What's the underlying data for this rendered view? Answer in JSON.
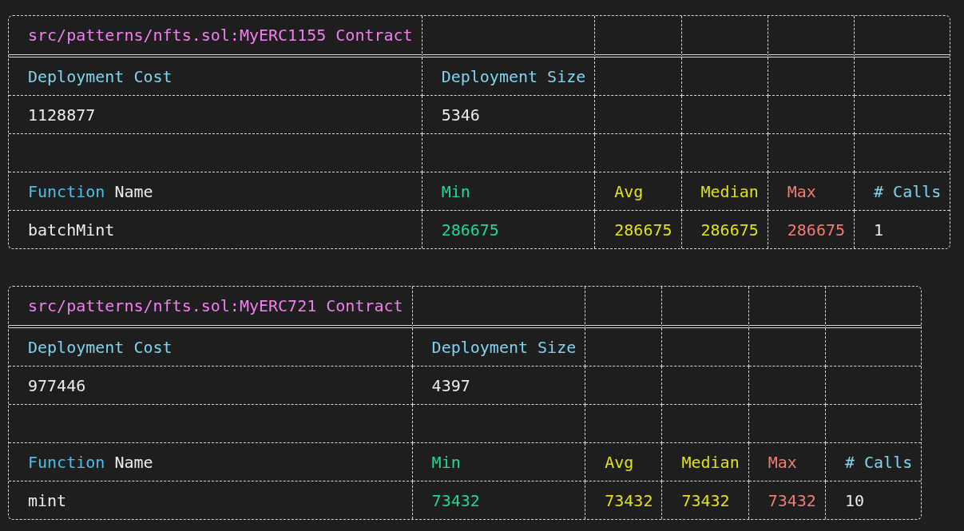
{
  "tables": [
    {
      "title": "src/patterns/nfts.sol:MyERC1155 Contract",
      "rows": [
        {
          "kind": "data",
          "cells": [
            {
              "parts": [
                {
                  "text": "Deployment Cost",
                  "color": "#7fd4ef"
                }
              ]
            },
            {
              "parts": [
                {
                  "text": "Deployment Size",
                  "color": "#7fd4ef"
                }
              ]
            }
          ]
        },
        {
          "kind": "data",
          "cells": [
            {
              "parts": [
                {
                  "text": "1128877",
                  "color": "#ececec"
                }
              ]
            },
            {
              "parts": [
                {
                  "text": "5346",
                  "color": "#ececec"
                }
              ]
            }
          ]
        },
        {
          "kind": "blank"
        },
        {
          "kind": "data",
          "cells": [
            {
              "parts": [
                {
                  "text": "Function",
                  "color": "#4cc0ea"
                },
                {
                  "text": "Name",
                  "color": "#ececec"
                }
              ]
            },
            {
              "parts": [
                {
                  "text": "Min",
                  "color": "#23d890"
                }
              ]
            },
            {
              "parts": [
                {
                  "text": "Avg",
                  "color": "#e2e01a"
                }
              ]
            },
            {
              "parts": [
                {
                  "text": "Median",
                  "color": "#e2e01a"
                }
              ]
            },
            {
              "parts": [
                {
                  "text": "Max",
                  "color": "#f27c74"
                }
              ]
            },
            {
              "parts": [
                {
                  "text": "# Calls",
                  "color": "#7fd4ef"
                }
              ]
            }
          ]
        },
        {
          "kind": "data",
          "cells": [
            {
              "parts": [
                {
                  "text": "batchMint",
                  "color": "#ececec"
                }
              ]
            },
            {
              "parts": [
                {
                  "text": "286675",
                  "color": "#23d890"
                }
              ]
            },
            {
              "parts": [
                {
                  "text": "286675",
                  "color": "#e2e01a"
                }
              ]
            },
            {
              "parts": [
                {
                  "text": "286675",
                  "color": "#e2e01a"
                }
              ]
            },
            {
              "parts": [
                {
                  "text": "286675",
                  "color": "#f27c74"
                }
              ]
            },
            {
              "parts": [
                {
                  "text": "1",
                  "color": "#ececec"
                }
              ]
            }
          ]
        }
      ]
    },
    {
      "title": "src/patterns/nfts.sol:MyERC721 Contract",
      "rows": [
        {
          "kind": "data",
          "cells": [
            {
              "parts": [
                {
                  "text": "Deployment Cost",
                  "color": "#7fd4ef"
                }
              ]
            },
            {
              "parts": [
                {
                  "text": "Deployment Size",
                  "color": "#7fd4ef"
                }
              ]
            }
          ]
        },
        {
          "kind": "data",
          "cells": [
            {
              "parts": [
                {
                  "text": "977446",
                  "color": "#ececec"
                }
              ]
            },
            {
              "parts": [
                {
                  "text": "4397",
                  "color": "#ececec"
                }
              ]
            }
          ]
        },
        {
          "kind": "blank"
        },
        {
          "kind": "data",
          "cells": [
            {
              "parts": [
                {
                  "text": "Function",
                  "color": "#4cc0ea"
                },
                {
                  "text": "Name",
                  "color": "#ececec"
                }
              ]
            },
            {
              "parts": [
                {
                  "text": "Min",
                  "color": "#23d890"
                }
              ]
            },
            {
              "parts": [
                {
                  "text": "Avg",
                  "color": "#e2e01a"
                }
              ]
            },
            {
              "parts": [
                {
                  "text": "Median",
                  "color": "#e2e01a"
                }
              ]
            },
            {
              "parts": [
                {
                  "text": "Max",
                  "color": "#f27c74"
                }
              ]
            },
            {
              "parts": [
                {
                  "text": "# Calls",
                  "color": "#7fd4ef"
                }
              ]
            }
          ]
        },
        {
          "kind": "data",
          "cells": [
            {
              "parts": [
                {
                  "text": "mint",
                  "color": "#ececec"
                }
              ]
            },
            {
              "parts": [
                {
                  "text": "73432",
                  "color": "#23d890"
                }
              ]
            },
            {
              "parts": [
                {
                  "text": "73432",
                  "color": "#e2e01a"
                }
              ]
            },
            {
              "parts": [
                {
                  "text": "73432",
                  "color": "#e2e01a"
                }
              ]
            },
            {
              "parts": [
                {
                  "text": "73432",
                  "color": "#f27c74"
                }
              ]
            },
            {
              "parts": [
                {
                  "text": "10",
                  "color": "#ececec"
                }
              ]
            }
          ]
        }
      ]
    }
  ]
}
